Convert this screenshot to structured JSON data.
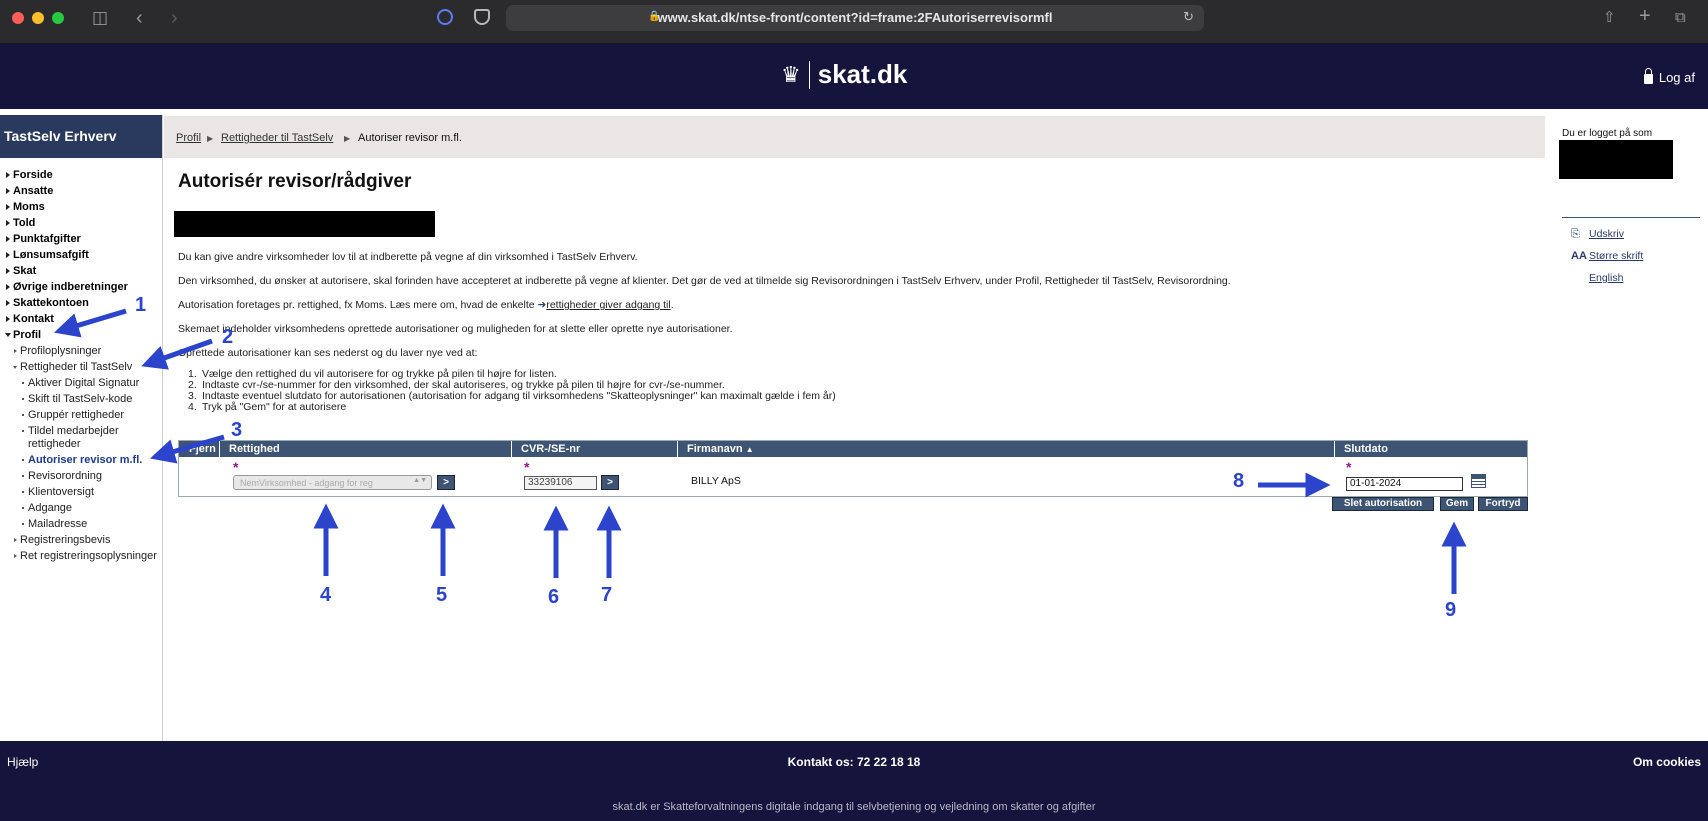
{
  "browser": {
    "url": "www.skat.dk/ntse-front/content?id=frame:2FAutoriserrevisormfl"
  },
  "header": {
    "logo_text": "skat.dk",
    "logout_label": "Log af"
  },
  "sidebar": {
    "title": "TastSelv Erhverv",
    "items": [
      {
        "label": "Forside"
      },
      {
        "label": "Ansatte"
      },
      {
        "label": "Moms"
      },
      {
        "label": "Told"
      },
      {
        "label": "Punktafgifter"
      },
      {
        "label": "Lønsumsafgift"
      },
      {
        "label": "Skat"
      },
      {
        "label": "Øvrige indberetninger"
      },
      {
        "label": "Skattekontoen"
      },
      {
        "label": "Kontakt"
      },
      {
        "label": "Profil"
      }
    ],
    "profil_items": {
      "profiloplysninger": "Profiloplysninger",
      "rettigheder": "Rettigheder til TastSelv",
      "registreringsbevis": "Registreringsbevis",
      "ret_reg": "Ret registreringsoplysninger"
    },
    "rettigheder_items": [
      {
        "label": "Aktiver Digital Signatur"
      },
      {
        "label": "Skift til TastSelv-kode"
      },
      {
        "label": "Gruppér rettigheder"
      },
      {
        "label": "Tildel medarbejder rettigheder"
      },
      {
        "label": "Autoriser revisor m.fl."
      },
      {
        "label": "Revisorordning"
      },
      {
        "label": "Klientoversigt"
      },
      {
        "label": "Adgange"
      },
      {
        "label": "Mailadresse"
      }
    ]
  },
  "breadcrumb": {
    "item1": "Profil",
    "item2": "Rettigheder til TastSelv",
    "current": "Autoriser revisor m.fl."
  },
  "main": {
    "title": "Autorisér revisor/rådgiver",
    "p1": "Du kan give andre virksomheder lov til at indberette på vegne af din virksomhed i TastSelv Erhverv.",
    "p2": "Den virksomhed, du ønsker at autorisere, skal forinden have accepteret at indberette på vegne af klienter. Det gør de ved at tilmelde sig Revisorordningen i TastSelv Erhverv, under Profil, Rettigheder til TastSelv, Revisorordning.",
    "p3_before": "Autorisation foretages pr. rettighed, fx Moms. Læs mere om, hvad de enkelte",
    "p3_link": "rettigheder giver adgang til",
    "p3_after": ".",
    "p4": "Skemaet indeholder virksomhedens oprettede autorisationer og muligheden for at slette eller oprette nye autorisationer.",
    "p5": "Oprettede autorisationer kan ses nederst og du laver nye ved at:",
    "steps": [
      "Vælge den rettighed du vil autorisere for og trykke på pilen til højre for listen.",
      "Indtaste cvr-/se-nummer for den virksomhed, der skal autoriseres, og trykke på pilen til højre for cvr-/se-nummer.",
      "Indtaste eventuel slutdato for autorisationen (autorisation for adgang til virksomhedens \"Skatteoplysninger\" kan maximalt gælde i fem år)",
      "Tryk på \"Gem\" for at autorisere"
    ],
    "step_numbers": [
      "1.",
      "2.",
      "3.",
      "4."
    ]
  },
  "table": {
    "headers": {
      "fjern": "Fjern",
      "rettighed": "Rettighed",
      "cvr": "CVR-/SE-nr",
      "firmanavn": "Firmanavn",
      "slutdato": "Slutdato"
    },
    "required_marker": "*",
    "rettighed_value": "NemVirksomhed - adgang for reg",
    "go_label": ">",
    "cvr_value": "33239106",
    "firm_name": "BILLY ApS",
    "slutdato_value": "01-01-2024",
    "buttons": {
      "slet": "Slet autorisation",
      "gem": "Gem",
      "fortryd": "Fortryd"
    }
  },
  "annotations": [
    "1",
    "2",
    "3",
    "4",
    "5",
    "6",
    "7",
    "8",
    "9"
  ],
  "right_panel": {
    "logged_in_label": "Du er logget på som",
    "links": {
      "print": "Udskriv",
      "larger_text": "Større skrift",
      "english": "English"
    }
  },
  "footer": {
    "help": "Hjælp",
    "contact": "Kontakt os: 72 22 18 18",
    "cookies": "Om cookies",
    "tagline": "skat.dk er Skatteforvaltningens digitale indgang til selvbetjening og vejledning om skatter og afgifter"
  }
}
